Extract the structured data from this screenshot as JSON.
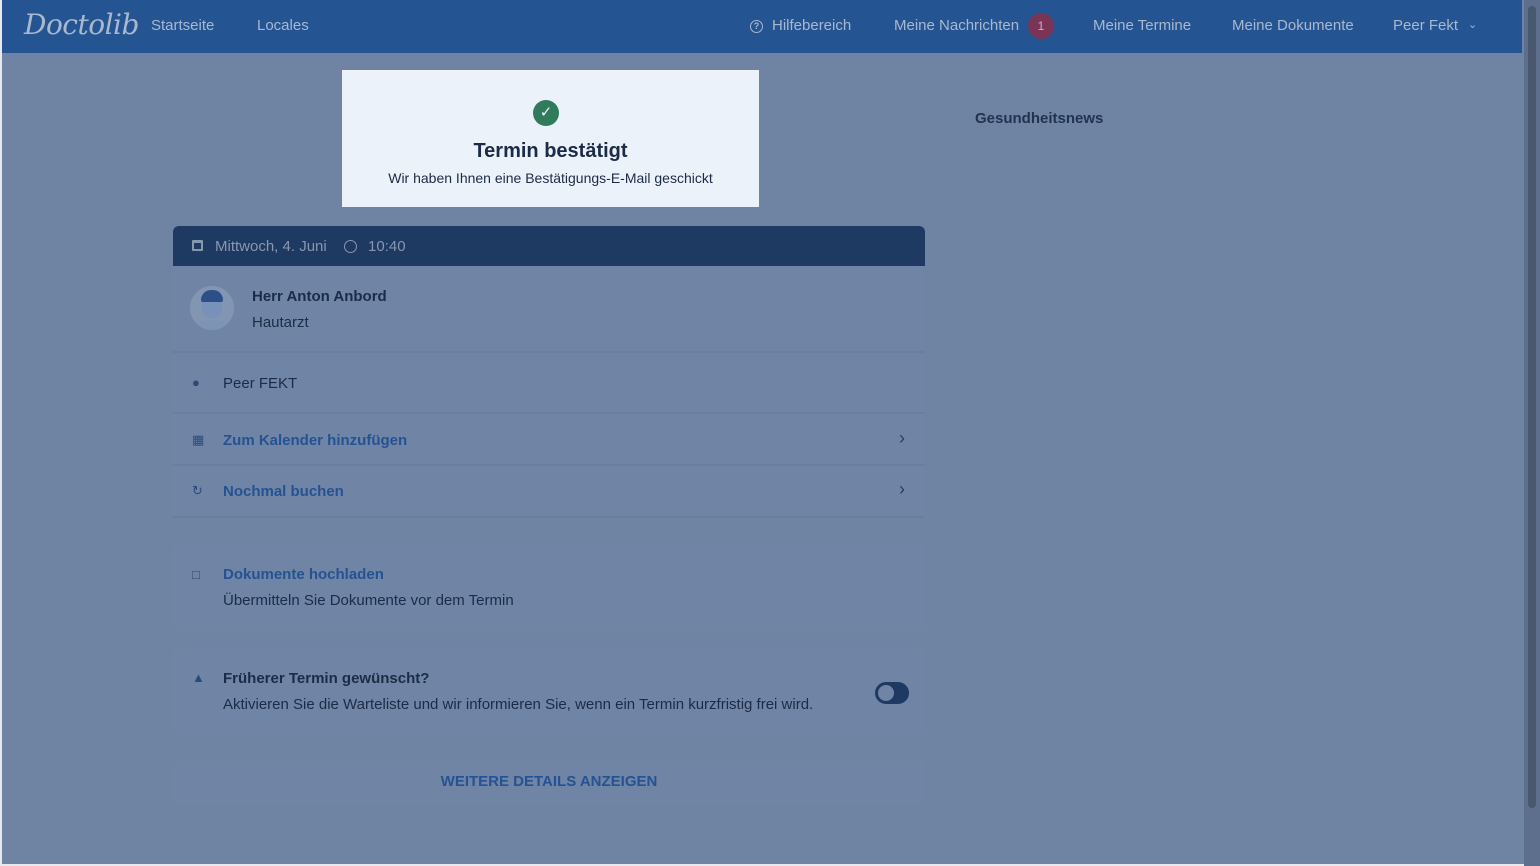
{
  "header": {
    "logo": "Doctolib",
    "nav_left": [
      "Startseite",
      "Locales"
    ],
    "help": "Hilfebereich",
    "messages": "Meine Nachrichten",
    "messages_count": "1",
    "appointments": "Meine Termine",
    "documents": "Meine Dokumente",
    "user": "Peer Fekt"
  },
  "toast": {
    "title": "Termin bestätigt",
    "subtitle": "Wir haben Ihnen eine Bestätigungs-E-Mail geschickt"
  },
  "sidebar": {
    "title": "Gesundheitsnews"
  },
  "appointment": {
    "date": "Mittwoch, 4. Juni",
    "time": "10:40",
    "doctor_name": "Herr Anton Anbord",
    "doctor_specialty": "Hautarzt",
    "patient": "Peer FEKT",
    "add_calendar": "Zum Kalender hinzufügen",
    "book_again": "Nochmal buchen"
  },
  "documents": {
    "title": "Dokumente hochladen",
    "subtitle": "Übermitteln Sie Dokumente vor dem Termin"
  },
  "waitlist": {
    "title": "Früherer Termin gewünscht?",
    "subtitle": "Aktivieren Sie die Warteliste und wir informieren Sie, wenn ein Termin kurzfristig frei wird.",
    "enabled": false
  },
  "more_details": "WEITERE DETAILS ANZEIGEN",
  "colors": {
    "topbar": "#245592",
    "overlay": "#6f83a3",
    "accent_link": "#245293",
    "success": "#2f7b5b"
  }
}
